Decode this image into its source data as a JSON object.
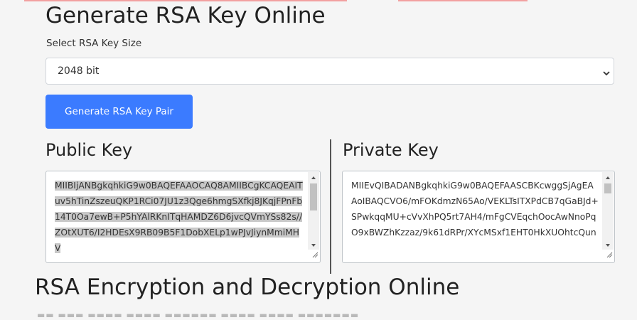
{
  "header": {
    "title": "Generate RSA Key Online"
  },
  "key_size": {
    "label": "Select RSA Key Size",
    "selected": "2048 bit"
  },
  "actions": {
    "generate_label": "Generate RSA Key Pair"
  },
  "public_key": {
    "title": "Public Key",
    "value": "MIIBIjANBgkqhkiG9w0BAQEFAAOCAQ8AMIIBCgKCAQEAITuv5hTinZszeuQKP1RCi07JU1z3Qge6hmgSXfkj8JKqjFPnFb14T0Oa7ewB+P5hYAlRKnITqHAMDZ6D6jvcQVmYSs82s//ZOtXUT6/I2HDEsX9RB09B5F1DobXELp1wPJvJiynMmiMHV"
  },
  "private_key": {
    "title": "Private Key",
    "value": "MIIEvQIBADANBgkqhkiG9w0BAQEFAASCBKcwggSjAgEAAoIBAQCVO6/mFOKdmzN65Ao/VEKLTsITXPdCB7qGaBJd+SPwkqqMU+cVvXhPQ5rt7AH4/mFgCVEqchOocAwNnoPqO9xBWZhKzzaz/9k61dRPr/XYcMSxf1EHT0HkXUOhtcQun"
  },
  "section2": {
    "title": "RSA Encryption and Decryption Online"
  },
  "colors": {
    "primary_button": "#3b7bff",
    "page_background": "#f5f5f5",
    "selection_highlight": "#c8c8c8"
  },
  "icons": {
    "select": "chevron-down-icon",
    "scroll_up": "triangle-up-icon",
    "scroll_down": "triangle-down-icon",
    "resize": "resize-grip-icon"
  }
}
